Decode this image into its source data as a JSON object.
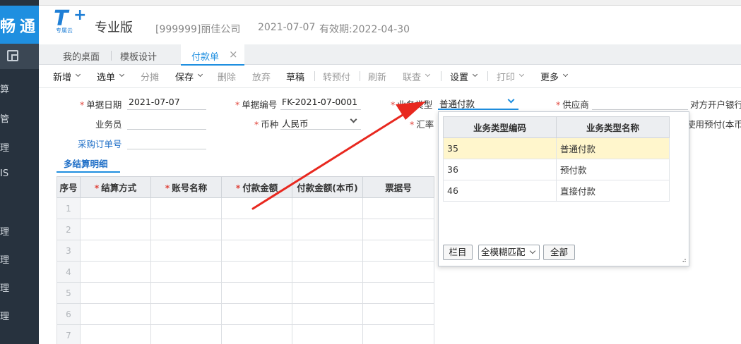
{
  "sidebar": {
    "brand": "畅通",
    "items": [
      "算",
      "管",
      "理",
      "IS",
      "理",
      "理",
      "理",
      "理"
    ]
  },
  "header": {
    "logo_main": "T",
    "logo_plus": "+",
    "logo_sub": "专属云",
    "edition": "专业版",
    "company": "[999999]丽佳公司",
    "date": "2021-07-07",
    "validity": "有效期:2022-04-30"
  },
  "tabs": {
    "desktop": "我的桌面",
    "template": "模板设计",
    "payment": "付款单",
    "close_glyph": "×"
  },
  "toolbar": {
    "new": "新增",
    "select": "选单",
    "split": "分摊",
    "save": "保存",
    "delete": "删除",
    "discard": "放弃",
    "draft": "草稿",
    "to_prepay": "转预付",
    "refresh": "刷新",
    "link_query": "联查",
    "settings": "设置",
    "print": "打印",
    "more": "更多"
  },
  "form": {
    "doc_date_label": "单据日期",
    "doc_date_value": "2021-07-07",
    "doc_no_label": "单据编号",
    "doc_no_value": "FK-2021-07-0001",
    "biz_type_label": "业务类型",
    "biz_type_value": "普通付款",
    "supplier_label": "供应商",
    "counterparty_bank_label": "对方开户银行",
    "salesperson_label": "业务员",
    "currency_label": "币种",
    "currency_value": "人民币",
    "exchange_rate_label": "汇率",
    "use_prepay_label": "使用预付(本币",
    "po_no_label": "采购订单号"
  },
  "subtab": {
    "label": "多结算明细"
  },
  "grid": {
    "columns": [
      "序号",
      "结算方式",
      "账号名称",
      "付款金额",
      "付款金额(本币)",
      "票据号"
    ],
    "required": [
      false,
      true,
      true,
      true,
      false,
      false
    ],
    "rows": [
      "1",
      "2",
      "3",
      "4",
      "5",
      "6",
      "7"
    ]
  },
  "popup": {
    "columns": [
      "业务类型编码",
      "业务类型名称"
    ],
    "rows": [
      {
        "code": "35",
        "name": "普通付款"
      },
      {
        "code": "36",
        "name": "预付款"
      },
      {
        "code": "46",
        "name": "直接付款"
      }
    ],
    "columns_button": "栏目",
    "match_mode": "全模糊匹配",
    "all_button": "全部",
    "resize_glyph": "⠴"
  },
  "colors": {
    "accent": "#1f8fe0",
    "sidebar_bg": "#27323e",
    "required_mark": "#e0433a",
    "selected_row": "#fff6cc",
    "arrow": "#e8281f"
  },
  "icons": {
    "dropdown": "chevron-down-icon",
    "close": "close-icon",
    "sidebar_square": "sidebar-square-icon",
    "arrow": "red-arrow-annotation"
  }
}
